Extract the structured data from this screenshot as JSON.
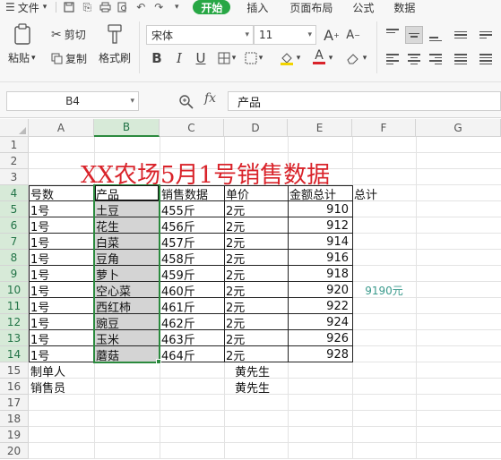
{
  "menu": {
    "file": "文件",
    "start": "开始",
    "tabs": [
      "插入",
      "页面布局",
      "公式",
      "数据"
    ]
  },
  "ribbon": {
    "paste": "粘贴",
    "cut": "剪切",
    "copy": "复制",
    "format_painter": "格式刷",
    "font_name": "宋体",
    "font_size": "11"
  },
  "formula_bar": {
    "name_box": "B4",
    "fx_label": "fx",
    "content": "产品"
  },
  "grid": {
    "columns": [
      "A",
      "B",
      "C",
      "D",
      "E",
      "F",
      "G"
    ],
    "rows": [
      "1",
      "2",
      "3",
      "4",
      "5",
      "6",
      "7",
      "8",
      "9",
      "10",
      "11",
      "12",
      "13",
      "14",
      "15",
      "16",
      "17",
      "18",
      "19",
      "20"
    ],
    "title": "XX农场5月1号销售数据",
    "headers": {
      "a": "号数",
      "b": "产品",
      "c": "销售数据",
      "d": "单价",
      "e": "金额总计",
      "f": "总计"
    },
    "data_rows": [
      {
        "a": "1号",
        "b": "土豆",
        "c": "455斤",
        "d": "2元",
        "e": "910"
      },
      {
        "a": "1号",
        "b": "花生",
        "c": "456斤",
        "d": "2元",
        "e": "912"
      },
      {
        "a": "1号",
        "b": "白菜",
        "c": "457斤",
        "d": "2元",
        "e": "914"
      },
      {
        "a": "1号",
        "b": "豆角",
        "c": "458斤",
        "d": "2元",
        "e": "916"
      },
      {
        "a": "1号",
        "b": "萝卜",
        "c": "459斤",
        "d": "2元",
        "e": "918"
      },
      {
        "a": "1号",
        "b": "空心菜",
        "c": "460斤",
        "d": "2元",
        "e": "920"
      },
      {
        "a": "1号",
        "b": "西红柿",
        "c": "461斤",
        "d": "2元",
        "e": "922"
      },
      {
        "a": "1号",
        "b": "豌豆",
        "c": "462斤",
        "d": "2元",
        "e": "924"
      },
      {
        "a": "1号",
        "b": "玉米",
        "c": "463斤",
        "d": "2元",
        "e": "926"
      },
      {
        "a": "1号",
        "b": "蘑菇",
        "c": "464斤",
        "d": "2元",
        "e": "928"
      }
    ],
    "total_value": "9190元",
    "footer": [
      {
        "label": "制单人",
        "name": "黄先生"
      },
      {
        "label": "销售员",
        "name": "黄先生"
      }
    ]
  },
  "colors": {
    "accent": "#28a745",
    "selection": "#2b8a3e",
    "title": "#d9232a",
    "total": "#3a9a8c"
  }
}
